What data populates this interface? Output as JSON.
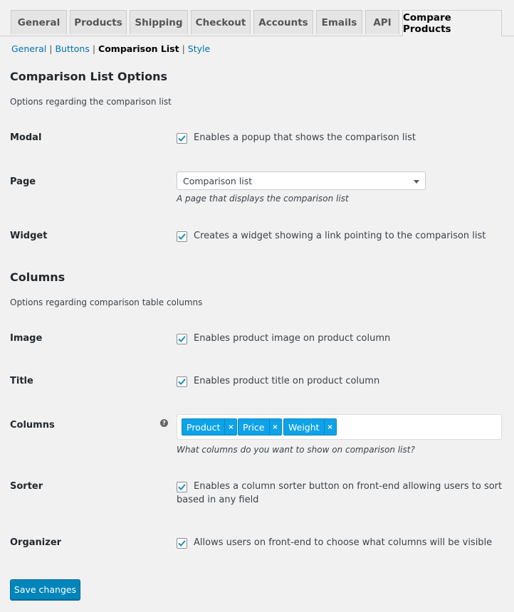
{
  "tabs": [
    "General",
    "Products",
    "Shipping",
    "Checkout",
    "Accounts",
    "Emails",
    "API",
    "Compare Products"
  ],
  "subnav": {
    "general": "General",
    "buttons": "Buttons",
    "comparison_list": "Comparison List",
    "style": "Style",
    "sep": "|"
  },
  "section1": {
    "title": "Comparison List Options",
    "desc": "Options regarding the comparison list"
  },
  "modal": {
    "label": "Modal",
    "text": "Enables a popup that shows the comparison list",
    "checked": true
  },
  "page": {
    "label": "Page",
    "value": "Comparison list",
    "hint": "A page that displays the comparison list"
  },
  "widget": {
    "label": "Widget",
    "text": "Creates a widget showing a link pointing to the comparison list",
    "checked": true
  },
  "section2": {
    "title": "Columns",
    "desc": "Options regarding comparison table columns"
  },
  "image": {
    "label": "Image",
    "text": "Enables product image on product column",
    "checked": true
  },
  "title_opt": {
    "label": "Title",
    "text": "Enables product title on product column",
    "checked": true
  },
  "columns": {
    "label": "Columns",
    "help": "?",
    "tokens": [
      "Product",
      "Price",
      "Weight"
    ],
    "remove": "×",
    "hint": "What columns do you want to show on comparison list?"
  },
  "sorter": {
    "label": "Sorter",
    "line1": "Enables a column sorter button on front-end allowing users to sort",
    "line2": "based in any field",
    "checked": true
  },
  "organizer": {
    "label": "Organizer",
    "text": "Allows users on front-end to choose what columns will be visible",
    "checked": true
  },
  "save_label": "Save changes",
  "colors": {
    "link": "#0073aa",
    "token": "#0ea2e8",
    "button": "#0085ba",
    "check": "#1e8cbe"
  }
}
